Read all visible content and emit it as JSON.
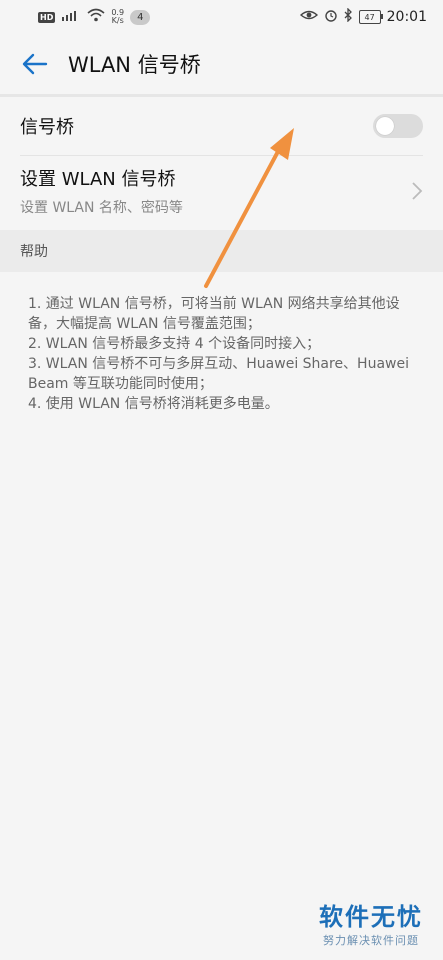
{
  "status_bar": {
    "hd_badge": "HD",
    "signal_label": "⁴G",
    "net_rate_value": "0.9",
    "net_rate_unit": "K/s",
    "notification_count": "4",
    "battery_level": "47",
    "time": "20:01"
  },
  "app_bar": {
    "title": "WLAN 信号桥"
  },
  "settings": {
    "toggle_label": "信号桥",
    "toggle_on": false,
    "setup_title": "设置 WLAN 信号桥",
    "setup_subtitle": "设置 WLAN 名称、密码等"
  },
  "help": {
    "header": "帮助",
    "lines": [
      "1. 通过 WLAN 信号桥，可将当前 WLAN 网络共享给其他设备，大幅提高 WLAN 信号覆盖范围；",
      "2. WLAN 信号桥最多支持 4 个设备同时接入；",
      "3. WLAN 信号桥不可与多屏互动、Huawei Share、Huawei Beam 等互联功能同时使用；",
      "4. 使用 WLAN 信号桥将消耗更多电量。"
    ]
  },
  "watermark": {
    "title": "软件无忧",
    "subtitle": "努力解决软件问题"
  },
  "colors": {
    "accent": "#1a73c8",
    "annotation_arrow": "#f0913f"
  }
}
